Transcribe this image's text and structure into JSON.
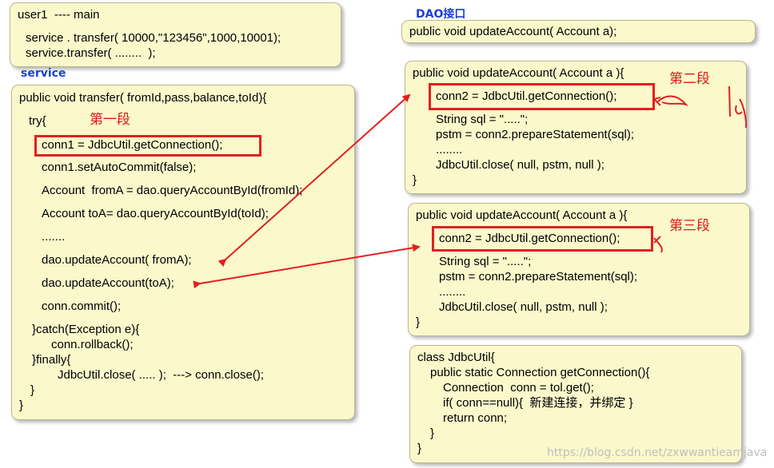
{
  "main_box": {
    "title": "user1  ---- main",
    "lines": [
      "service . transfer( 10000,\"123456\",1000,10001);",
      "service.transfer( ........  );"
    ]
  },
  "service_label": "service",
  "dao_label": "DAO接口",
  "dao_interface": "public void updateAccount( Account a);",
  "service_box": {
    "lines": [
      "public void transfer( fromId,pass,balance,toId){",
      "try{",
      "conn1 = JdbcUtil.getConnection();",
      "conn1.setAutoCommit(false);",
      "Account  fromA = dao.queryAccountById(fromId);",
      "Account toA= dao.queryAccountById(toId);",
      ".......",
      "dao.updateAccount( fromA);",
      "dao.updateAccount(toA);",
      "conn.commit();",
      "}catch(Exception e){",
      "conn.rollback();",
      "}finally{",
      "JdbcUtil.close( ..... );  ---> conn.close();",
      "}",
      "}"
    ]
  },
  "dao_impl_1": {
    "lines": [
      "public void updateAccount( Account a ){",
      "conn2 = JdbcUtil.getConnection();",
      "String sql = \".....\";",
      "pstm = conn2.prepareStatement(sql);",
      "........",
      "JdbcUtil.close( null, pstm, null );",
      "}"
    ]
  },
  "dao_impl_2": {
    "lines": [
      "public void updateAccount( Account a ){",
      "conn2 = JdbcUtil.getConnection();",
      "String sql = \".....\";",
      "pstm = conn2.prepareStatement(sql);",
      "........",
      "JdbcUtil.close( null, pstm, null );",
      "}"
    ]
  },
  "jdbc_util": {
    "lines": [
      "class JdbcUtil{",
      "public static Connection getConnection(){",
      "Connection  conn = tol.get();",
      "if( conn==null){  新建连接，并绑定 }",
      "return conn;",
      "}",
      "}"
    ]
  },
  "segment_labels": [
    "第一段",
    "第二段",
    "第三段"
  ],
  "watermark": "https://blog.csdn.net/zxwwantieamjava",
  "colors": {
    "box_fill": "#fbf8cc",
    "highlight": "#e02020",
    "label_blue": "#1a3fd8"
  }
}
